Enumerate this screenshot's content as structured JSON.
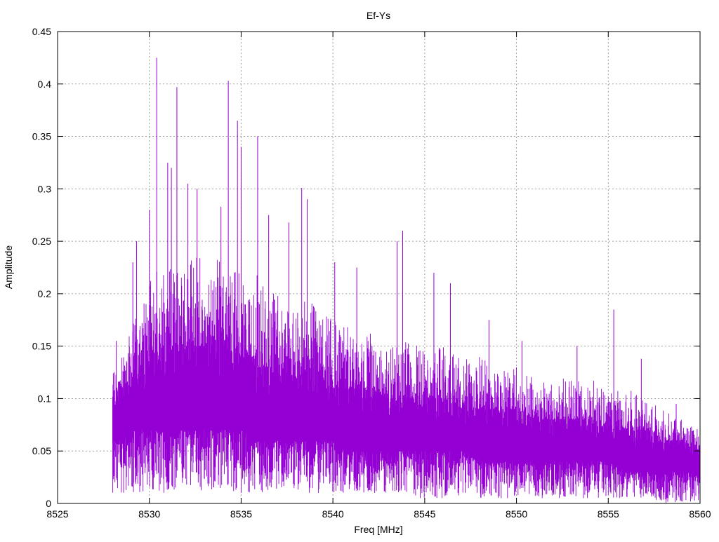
{
  "chart_data": {
    "type": "line",
    "title": "Ef-Ys",
    "xlabel": "Freq [MHz]",
    "ylabel": "Amplitude",
    "xlim": [
      8525,
      8560
    ],
    "ylim": [
      0,
      0.45
    ],
    "grid": true,
    "legend": "none",
    "color": "#9400d3",
    "x_ticks": [
      "8525",
      "8530",
      "8535",
      "8540",
      "8545",
      "8550",
      "8555",
      "8560"
    ],
    "x_tick_values": [
      8525,
      8530,
      8535,
      8540,
      8545,
      8550,
      8555,
      8560
    ],
    "y_ticks": [
      "0",
      "0.05",
      "0.1",
      "0.15",
      "0.2",
      "0.25",
      "0.3",
      "0.35",
      "0.4",
      "0.45"
    ],
    "y_tick_values": [
      0,
      0.05,
      0.1,
      0.15,
      0.2,
      0.25,
      0.3,
      0.35,
      0.4,
      0.45
    ],
    "envelope": {
      "x": [
        8528,
        8529,
        8530,
        8531,
        8532,
        8533,
        8534,
        8535,
        8536,
        8537,
        8538,
        8539,
        8540,
        8541,
        8542,
        8543,
        8544,
        8545,
        8546,
        8547,
        8548,
        8549,
        8550,
        8551,
        8552,
        8553,
        8554,
        8555,
        8556,
        8557,
        8558,
        8559,
        8560
      ],
      "max": [
        0.13,
        0.17,
        0.22,
        0.24,
        0.24,
        0.24,
        0.24,
        0.23,
        0.22,
        0.2,
        0.2,
        0.19,
        0.18,
        0.17,
        0.17,
        0.16,
        0.16,
        0.15,
        0.15,
        0.14,
        0.14,
        0.13,
        0.13,
        0.12,
        0.12,
        0.12,
        0.12,
        0.11,
        0.11,
        0.1,
        0.09,
        0.08,
        0.07
      ],
      "core_top": [
        0.1,
        0.12,
        0.14,
        0.15,
        0.15,
        0.15,
        0.15,
        0.14,
        0.13,
        0.13,
        0.12,
        0.12,
        0.11,
        0.11,
        0.11,
        0.1,
        0.1,
        0.1,
        0.1,
        0.09,
        0.09,
        0.09,
        0.09,
        0.08,
        0.08,
        0.08,
        0.08,
        0.07,
        0.07,
        0.07,
        0.06,
        0.06,
        0.05
      ],
      "core_bottom": [
        0.06,
        0.07,
        0.07,
        0.07,
        0.07,
        0.07,
        0.07,
        0.07,
        0.06,
        0.06,
        0.06,
        0.06,
        0.06,
        0.05,
        0.05,
        0.05,
        0.05,
        0.05,
        0.05,
        0.05,
        0.04,
        0.04,
        0.04,
        0.04,
        0.04,
        0.04,
        0.04,
        0.04,
        0.03,
        0.03,
        0.03,
        0.03,
        0.03
      ],
      "min": [
        0.01,
        0.01,
        0.01,
        0.01,
        0.01,
        0.01,
        0.01,
        0.01,
        0.01,
        0.01,
        0.01,
        0.01,
        0.01,
        0.01,
        0.01,
        0.01,
        0.005,
        0.005,
        0.005,
        0.005,
        0.005,
        0.005,
        0.005,
        0.005,
        0.005,
        0.005,
        0.005,
        0.005,
        0.005,
        0.005,
        0.0,
        0.0,
        0.0
      ]
    },
    "peaks": [
      {
        "x": 8528.2,
        "y": 0.155
      },
      {
        "x": 8529.1,
        "y": 0.23
      },
      {
        "x": 8529.3,
        "y": 0.25
      },
      {
        "x": 8530.0,
        "y": 0.28
      },
      {
        "x": 8530.4,
        "y": 0.425
      },
      {
        "x": 8531.0,
        "y": 0.325
      },
      {
        "x": 8531.2,
        "y": 0.32
      },
      {
        "x": 8531.5,
        "y": 0.397
      },
      {
        "x": 8532.1,
        "y": 0.305
      },
      {
        "x": 8532.6,
        "y": 0.3
      },
      {
        "x": 8533.9,
        "y": 0.283
      },
      {
        "x": 8534.3,
        "y": 0.403
      },
      {
        "x": 8534.8,
        "y": 0.365
      },
      {
        "x": 8535.0,
        "y": 0.34
      },
      {
        "x": 8535.9,
        "y": 0.35
      },
      {
        "x": 8536.5,
        "y": 0.275
      },
      {
        "x": 8537.6,
        "y": 0.268
      },
      {
        "x": 8538.3,
        "y": 0.301
      },
      {
        "x": 8538.6,
        "y": 0.29
      },
      {
        "x": 8540.1,
        "y": 0.23
      },
      {
        "x": 8541.3,
        "y": 0.225
      },
      {
        "x": 8543.5,
        "y": 0.25
      },
      {
        "x": 8543.8,
        "y": 0.26
      },
      {
        "x": 8545.5,
        "y": 0.22
      },
      {
        "x": 8546.4,
        "y": 0.21
      },
      {
        "x": 8548.5,
        "y": 0.175
      },
      {
        "x": 8550.3,
        "y": 0.155
      },
      {
        "x": 8553.3,
        "y": 0.15
      },
      {
        "x": 8555.3,
        "y": 0.185
      },
      {
        "x": 8556.8,
        "y": 0.138
      },
      {
        "x": 8558.7,
        "y": 0.095
      }
    ]
  }
}
